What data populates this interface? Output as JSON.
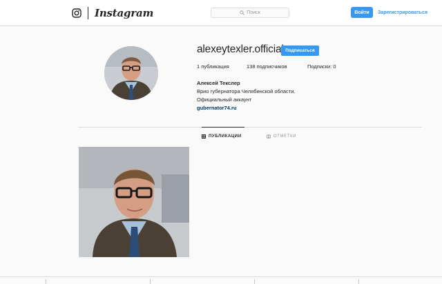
{
  "header": {
    "brand": "Instagram",
    "search_placeholder": "Поиск",
    "login_label": "Войти",
    "signup_label": "Зарегистрироваться"
  },
  "profile": {
    "username": "alexeytexler.official",
    "follow_label": "Подписаться",
    "posts_stat": "1 публикация",
    "followers_stat": "138 подписчиков",
    "following_stat": "Подписки: 0",
    "full_name": "Алексей Текслер",
    "bio_line1": "Врио губернатора Челябинской области.",
    "bio_line2": "Официальный аккаунт",
    "website": "gubernator74.ru"
  },
  "tabs": [
    {
      "label": "ПУБЛИКАЦИИ",
      "icon": "grid-icon",
      "active": true
    },
    {
      "label": "ОТМЕТКИ",
      "icon": "tag-icon",
      "active": false
    }
  ],
  "colors": {
    "accent": "#3897f0",
    "link": "#003569",
    "border": "#dbdbdb",
    "background": "#fafafa"
  }
}
